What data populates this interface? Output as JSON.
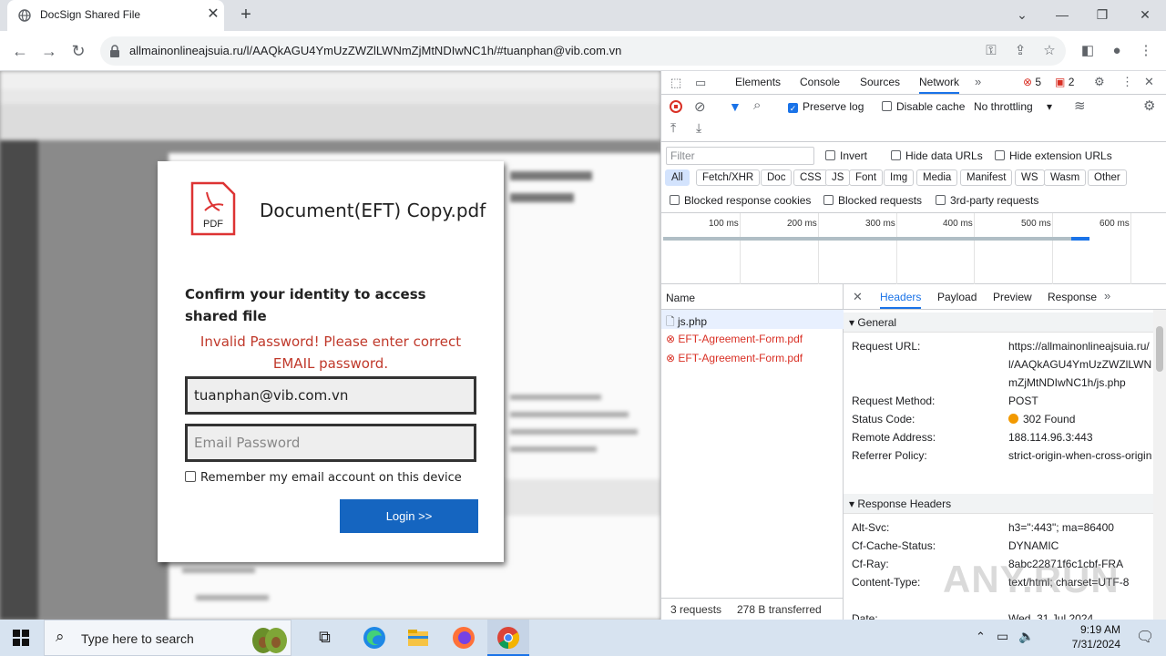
{
  "browser": {
    "tab_title": "DocSign Shared File",
    "url": "allmainonlineajsuia.ru/l/AAQkAGU4YmUzZWZlLWNmZjMtNDIwNC1h/#tuanphan@vib.com.vn"
  },
  "dialog": {
    "file_name": "Document(EFT) Copy.pdf",
    "pdf_label": "PDF",
    "heading": "Confirm your identity to access shared file",
    "error": "Invalid Password! Please enter correct EMAIL password.",
    "email_value": "tuanphan@vib.com.vn",
    "password_placeholder": "Email Password",
    "remember_label": "Remember my email account on this device",
    "login_label": "Login >>"
  },
  "devtools": {
    "tabs": [
      "Elements",
      "Console",
      "Sources",
      "Network"
    ],
    "error_count": "5",
    "issue_count": "2",
    "preserve_log": "Preserve log",
    "disable_cache": "Disable cache",
    "throttling": "No throttling",
    "filter_placeholder": "Filter",
    "invert": "Invert",
    "hide_data_urls": "Hide data URLs",
    "hide_extension_urls": "Hide extension URLs",
    "filter_types": [
      "All",
      "Fetch/XHR",
      "Doc",
      "CSS",
      "JS",
      "Font",
      "Img",
      "Media",
      "Manifest",
      "WS",
      "Wasm",
      "Other"
    ],
    "blocked_response_cookies": "Blocked response cookies",
    "blocked_requests": "Blocked requests",
    "third_party_requests": "3rd-party requests",
    "timeline_ticks": [
      "100 ms",
      "200 ms",
      "300 ms",
      "400 ms",
      "500 ms",
      "600 ms"
    ],
    "name_header": "Name",
    "requests": [
      "js.php",
      "EFT-Agreement-Form.pdf",
      "EFT-Agreement-Form.pdf"
    ],
    "footer_requests": "3 requests",
    "footer_transferred": "278 B transferred",
    "detail_tabs": [
      "Headers",
      "Payload",
      "Preview",
      "Response"
    ],
    "general_label": "General",
    "general": {
      "request_url_key": "Request URL:",
      "request_url_val": "https://allmainonlineajsuia.ru/l/AAQkAGU4YmUzZWZlLWNmZjMtNDIwNC1h/js.php",
      "method_key": "Request Method:",
      "method_val": "POST",
      "status_key": "Status Code:",
      "status_val": "302 Found",
      "remote_key": "Remote Address:",
      "remote_val": "188.114.96.3:443",
      "referrer_key": "Referrer Policy:",
      "referrer_val": "strict-origin-when-cross-origin"
    },
    "response_headers_label": "Response Headers",
    "response": {
      "altsvc_key": "Alt-Svc:",
      "altsvc_val": "h3=\":443\"; ma=86400",
      "cache_key": "Cf-Cache-Status:",
      "cache_val": "DYNAMIC",
      "ray_key": "Cf-Ray:",
      "ray_val": "8abc22871f6c1cbf-FRA",
      "ctype_key": "Content-Type:",
      "ctype_val": "text/html; charset=UTF-8",
      "date_key": "Date:",
      "date_val": "Wed, 31 Jul 2024"
    }
  },
  "taskbar": {
    "search_placeholder": "Type here to search",
    "time": "9:19 AM",
    "date": "7/31/2024"
  },
  "watermark": "ANY.RUN",
  "colors": {
    "login_button": "#1565c0",
    "error_text": "#c0392b",
    "devtools_accent": "#1a73e8"
  }
}
